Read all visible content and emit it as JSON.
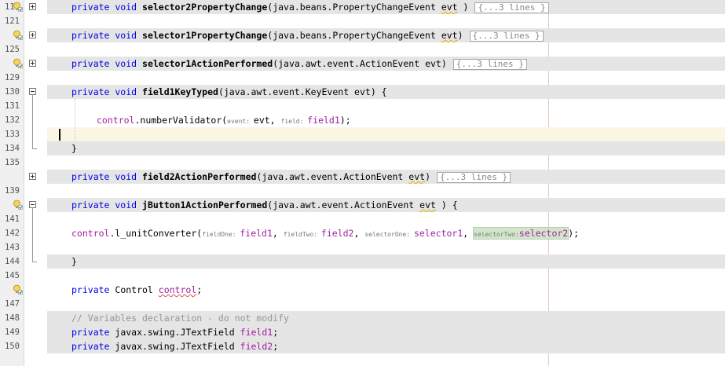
{
  "editor": {
    "lines": [
      {
        "num": "117",
        "fold": "plus",
        "bulb": true,
        "band": "grey",
        "parts": [
          [
            "kw",
            "private void "
          ],
          [
            "b",
            "selector2PropertyChange"
          ],
          [
            "",
            "(java.beans.PropertyChangeEvent "
          ],
          [
            "wavy",
            "evt"
          ],
          [
            "",
            " )"
          ]
        ],
        "fold_text": "{...3 lines }"
      },
      {
        "num": "121",
        "band": "none",
        "parts": []
      },
      {
        "num": "",
        "fold": "plus",
        "bulb": true,
        "band": "grey",
        "parts": [
          [
            "kw",
            "private void "
          ],
          [
            "b",
            "selector1PropertyChange"
          ],
          [
            "",
            "(java.beans.PropertyChangeEvent "
          ],
          [
            "wavy",
            "evt"
          ],
          [
            "",
            ")"
          ]
        ],
        "fold_text": "{...3 lines }"
      },
      {
        "num": "125",
        "band": "none",
        "parts": []
      },
      {
        "num": "",
        "fold": "plus",
        "bulb": true,
        "band": "grey",
        "parts": [
          [
            "kw",
            "private void "
          ],
          [
            "b",
            "selector1ActionPerformed"
          ],
          [
            "",
            "(java.awt.event.ActionEvent "
          ],
          [
            "",
            "evt"
          ],
          [
            "",
            ")"
          ]
        ],
        "fold_text": "{...3 lines }"
      },
      {
        "num": "129",
        "band": "none",
        "parts": []
      },
      {
        "num": "130",
        "fold": "minus",
        "band": "grey",
        "parts": [
          [
            "kw",
            "private void "
          ],
          [
            "b",
            "field1KeyTyped"
          ],
          [
            "",
            "(java.awt.event.KeyEvent evt) {"
          ]
        ]
      },
      {
        "num": "131",
        "band": "none",
        "parts": []
      },
      {
        "num": "132",
        "band": "none",
        "indent": 2,
        "parts": [
          [
            "fldp",
            "control"
          ],
          [
            "",
            ".numberValidator("
          ],
          [
            "hint",
            "event: "
          ],
          [
            "",
            "evt, "
          ],
          [
            "hint",
            "field: "
          ],
          [
            "fldp",
            "field1"
          ],
          [
            "",
            ");"
          ]
        ]
      },
      {
        "num": "133",
        "band": "cur",
        "caret": true,
        "parts": []
      },
      {
        "num": "134",
        "band": "grey",
        "parts": [
          [
            "",
            "}"
          ]
        ]
      },
      {
        "num": "135",
        "band": "none",
        "parts": []
      },
      {
        "num": "",
        "fold": "plus",
        "band": "grey",
        "parts": [
          [
            "kw",
            "private void "
          ],
          [
            "b",
            "field2ActionPerformed"
          ],
          [
            "",
            "(java.awt.event.ActionEvent "
          ],
          [
            "wavy",
            "evt"
          ],
          [
            "",
            ")"
          ]
        ],
        "fold_text": "{...3 lines }"
      },
      {
        "num": "139",
        "band": "none",
        "parts": []
      },
      {
        "num": "",
        "fold": "minus",
        "bulb": true,
        "band": "grey",
        "parts": [
          [
            "kw",
            "private void "
          ],
          [
            "b",
            "jButton1ActionPerformed"
          ],
          [
            "",
            "(java.awt.event.ActionEvent "
          ],
          [
            "wavy",
            "evt"
          ],
          [
            "",
            " ) {"
          ]
        ]
      },
      {
        "num": "141",
        "band": "none",
        "parts": []
      },
      {
        "num": "142",
        "band": "none",
        "parts": [
          [
            "fldp",
            "control"
          ],
          [
            "",
            ".l_unitConverter("
          ],
          [
            "hint",
            "fieldOne: "
          ],
          [
            "fldp",
            "field1"
          ],
          [
            "",
            ", "
          ],
          [
            "hint",
            "fieldTwo: "
          ],
          [
            "fldp",
            "field2"
          ],
          [
            "",
            ", "
          ],
          [
            "hint",
            "selectorOne: "
          ],
          [
            "fldp",
            "selector1"
          ],
          [
            "",
            ", "
          ],
          [
            "hlparam",
            ""
          ],
          [
            "",
            ");"
          ]
        ],
        "hl_hint": "selectorTwo:",
        "hl_value": "selector2"
      },
      {
        "num": "143",
        "band": "none",
        "parts": []
      },
      {
        "num": "144",
        "band": "grey",
        "parts": [
          [
            "",
            "}"
          ]
        ]
      },
      {
        "num": "145",
        "band": "none",
        "parts": []
      },
      {
        "num": "",
        "bulb": true,
        "band": "none",
        "parts": [
          [
            "kw",
            "private "
          ],
          [
            "",
            "Control "
          ],
          [
            "fldpw",
            "control"
          ],
          [
            "",
            ";"
          ]
        ]
      },
      {
        "num": "147",
        "band": "none",
        "parts": []
      },
      {
        "num": "148",
        "band": "grey",
        "parts": [
          [
            "cmt",
            "// Variables declaration - do not modify"
          ]
        ]
      },
      {
        "num": "149",
        "band": "grey",
        "parts": [
          [
            "kw",
            "private "
          ],
          [
            "",
            "javax.swing.JTextField "
          ],
          [
            "fldp",
            "field1"
          ],
          [
            "",
            ";"
          ]
        ]
      },
      {
        "num": "150",
        "band": "grey",
        "parts": [
          [
            "kw",
            "private "
          ],
          [
            "",
            "javax.swing.JTextField "
          ],
          [
            "fldp",
            "field2"
          ],
          [
            "",
            ";"
          ]
        ]
      }
    ]
  }
}
